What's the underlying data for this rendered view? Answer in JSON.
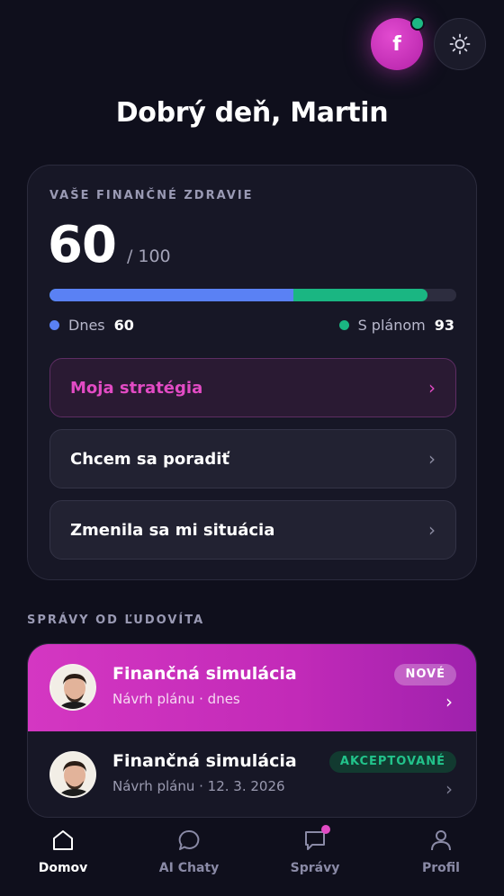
{
  "header": {
    "avatar_initial": "f",
    "greeting": "Dobrý deň, Martin"
  },
  "health": {
    "label": "VAŠE FINANČNÉ ZDRAVIE",
    "score": "60",
    "max": "/ 100",
    "today_fraction": 0.6,
    "plan_fraction": 0.93,
    "legend_today_label": "Dnes",
    "legend_today_value": "60",
    "legend_plan_label": "S plánom",
    "legend_plan_value": "93",
    "colors": {
      "today": "#5a81f4",
      "plan": "#1ab682"
    }
  },
  "actions": [
    {
      "label": "Moja stratégia"
    },
    {
      "label": "Chcem sa poradiť"
    },
    {
      "label": "Zmenila sa mi situácia"
    }
  ],
  "messages": {
    "label": "SPRÁVY OD ĽUDOVÍTA",
    "items": [
      {
        "title": "Finančná simulácia",
        "subtitle": "Návrh plánu · dnes",
        "badge": "NOVÉ"
      },
      {
        "title": "Finančná simulácia",
        "subtitle": "Návrh plánu · 12. 3. 2026",
        "badge": "AKCEPTOVANÉ"
      }
    ]
  },
  "nav": {
    "items": [
      {
        "label": "Domov",
        "icon": "home-icon"
      },
      {
        "label": "AI Chaty",
        "icon": "chat-bubble-icon"
      },
      {
        "label": "Správy",
        "icon": "message-square-icon"
      },
      {
        "label": "Profil",
        "icon": "user-icon"
      }
    ]
  }
}
